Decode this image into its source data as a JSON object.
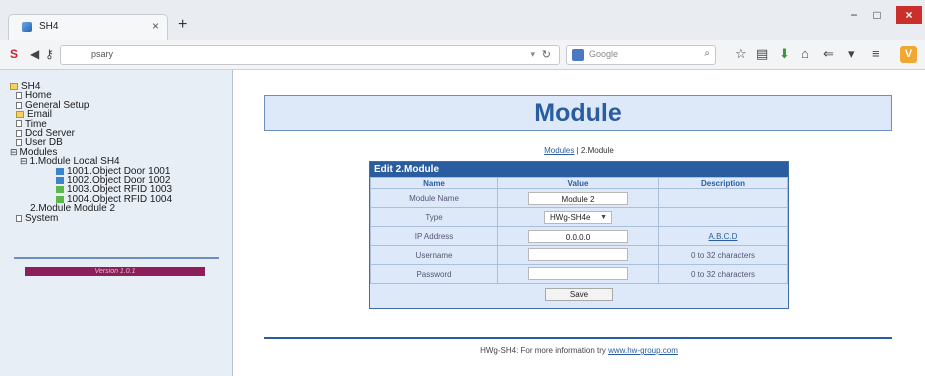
{
  "browser": {
    "tab_title": "SH4",
    "tab_close": "×",
    "new_tab": "+",
    "url": "psary",
    "search_placeholder": "Google",
    "window_min": "−",
    "window_max": "□",
    "window_close": "×"
  },
  "sidebar": {
    "root": "SH4",
    "items": [
      {
        "label": "Home"
      },
      {
        "label": "General Setup"
      },
      {
        "label": "Email"
      },
      {
        "label": "Time"
      },
      {
        "label": "Dcd Server"
      },
      {
        "label": "User DB"
      }
    ],
    "modules_label": "Modules",
    "module1": "1.Module Local SH4",
    "objects": [
      {
        "label": "1001.Object Door 1001",
        "kind": "door"
      },
      {
        "label": "1002.Object Door 1002",
        "kind": "door"
      },
      {
        "label": "1003.Object RFID 1003",
        "kind": "rfid"
      },
      {
        "label": "1004.Object RFID 1004",
        "kind": "rfid"
      }
    ],
    "module2": "2.Module Module 2",
    "system": "System",
    "version": "Version 1.0.1"
  },
  "page": {
    "title": "Module",
    "breadcrumb_link": "Modules",
    "breadcrumb_sep": " | ",
    "breadcrumb_current": "2.Module"
  },
  "form": {
    "heading": "Edit 2.Module",
    "columns": [
      "Name",
      "Value",
      "Description"
    ],
    "rows": {
      "module_name": {
        "label": "Module Name",
        "value": "Module 2",
        "desc": ""
      },
      "type": {
        "label": "Type",
        "value": "HWg-SH4e",
        "desc": ""
      },
      "ip": {
        "label": "IP Address",
        "value": "0.0.0.0",
        "desc": "A.B.C.D"
      },
      "username": {
        "label": "Username",
        "value": "",
        "desc": "0 to 32 characters"
      },
      "password": {
        "label": "Password",
        "value": "",
        "desc": "0 to 32 characters"
      }
    },
    "save_label": "Save"
  },
  "footer": {
    "text": "HWg-SH4: For more information try ",
    "link": "www.hw-group.com"
  },
  "colors": {
    "accent": "#2a5d9f",
    "panel_bg": "#dde9f8",
    "sidebar_bg": "#e8eef6",
    "version_bar": "#8c1f5a",
    "close_button": "#c9302c"
  }
}
